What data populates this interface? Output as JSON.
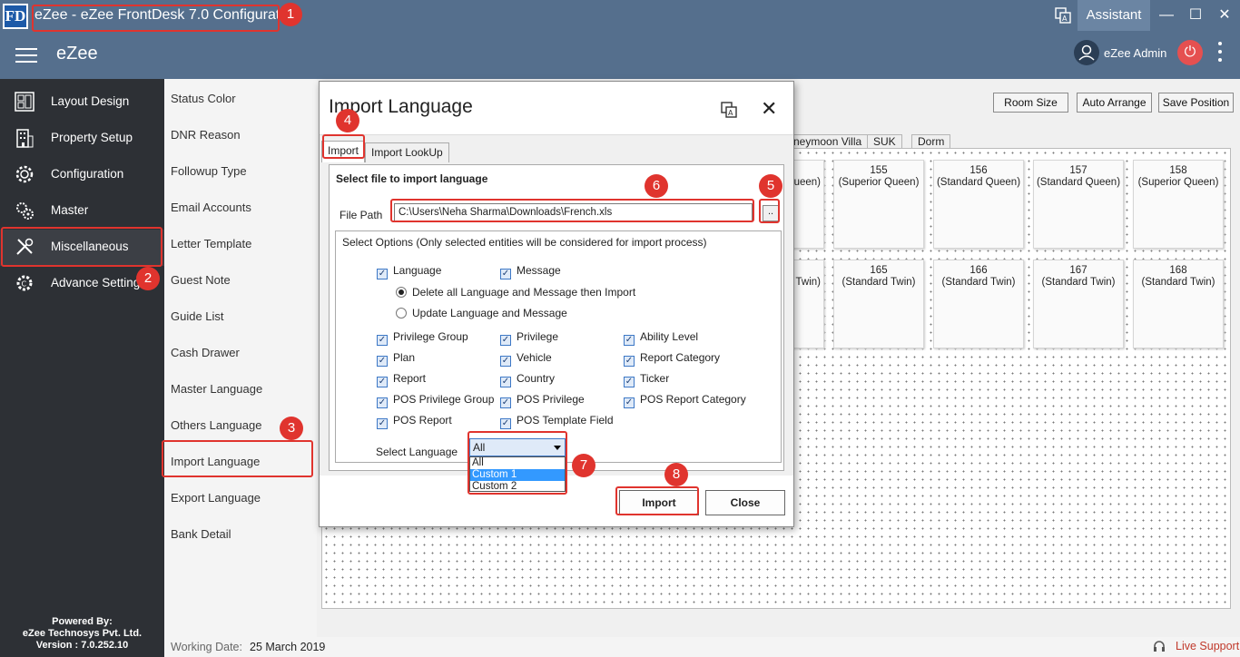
{
  "window": {
    "logo_text": "FD",
    "title": "eZee - eZee FrontDesk 7.0 Configuration",
    "assistant_label": "Assistant",
    "minimize": "—",
    "maximize": "☐",
    "close": "✕"
  },
  "header": {
    "brand": "eZee",
    "user_name": "eZee Admin",
    "power_icon": "⏻"
  },
  "sidebar": {
    "items": [
      {
        "label": "Layout Design",
        "icon": "layout-icon"
      },
      {
        "label": "Property Setup",
        "icon": "building-icon"
      },
      {
        "label": "Configuration",
        "icon": "gear-icon"
      },
      {
        "label": "Master",
        "icon": "gears-icon"
      },
      {
        "label": "Miscellaneous",
        "icon": "tools-icon"
      },
      {
        "label": "Advance Setting",
        "icon": "advance-gear-icon"
      }
    ],
    "footer": {
      "powered_by": "Powered By:",
      "company": "eZee Technosys Pvt. Ltd.",
      "version": "Version : 7.0.252.10"
    }
  },
  "submenu": {
    "items": [
      "Status Color",
      "DNR Reason",
      "Followup Type",
      "Email Accounts",
      "Letter Template",
      "Guest Note",
      "Guide List",
      "Cash Drawer",
      "Master Language",
      "Others Language",
      "Import Language",
      "Export Language",
      "Bank Detail"
    ]
  },
  "main": {
    "buttons": {
      "room_size": "Room Size",
      "auto_arrange": "Auto Arrange",
      "save_position": "Save Position"
    },
    "room_tabs": [
      "neymoon Villa",
      "SUK",
      "Dorm"
    ],
    "rooms_row1": [
      {
        "partial": "ueen)"
      },
      {
        "number": "155",
        "type": "(Superior Queen)"
      },
      {
        "number": "156",
        "type": "(Standard Queen)"
      },
      {
        "number": "157",
        "type": "(Standard Queen)"
      },
      {
        "number": "158",
        "type": "(Superior Queen)"
      }
    ],
    "rooms_row2": [
      {
        "partial": "Twin)"
      },
      {
        "number": "165",
        "type": "(Standard Twin)"
      },
      {
        "number": "166",
        "type": "(Standard Twin)"
      },
      {
        "number": "167",
        "type": "(Standard Twin)"
      },
      {
        "number": "168",
        "type": "(Standard Twin)"
      }
    ]
  },
  "statusbar": {
    "working_date_label": "Working Date:",
    "working_date_value": "25 March 2019",
    "live_support": "Live Support"
  },
  "dialog": {
    "title": "Import Language",
    "close": "✕",
    "tabs": [
      "Import",
      "Import LookUp"
    ],
    "section_title": "Select file to import language",
    "file_path_label": "File Path",
    "file_path_value": "C:\\Users\\Neha Sharma\\Downloads\\French.xls",
    "browse_label": "..",
    "options_title": "Select Options (Only selected entities will be considered for import process)",
    "check_language": "Language",
    "check_message": "Message",
    "radio_delete": "Delete all Language and Message then Import",
    "radio_update": "Update Language and Message",
    "entities": [
      [
        "Privilege Group",
        "Privilege",
        "Ability Level"
      ],
      [
        "Plan",
        "Vehicle",
        "Report Category"
      ],
      [
        "Report",
        "Country",
        "Ticker"
      ],
      [
        "POS Privilege Group",
        "POS Privilege",
        "POS Report Category"
      ],
      [
        "POS Report",
        "POS Template Field"
      ]
    ],
    "select_language_label": "Select Language",
    "select_language_value": "All",
    "dropdown_options": [
      "All",
      "Custom 1",
      "Custom 2"
    ],
    "import_button": "Import",
    "close_button": "Close",
    "check_mark": "✓"
  },
  "annotations": [
    "1",
    "2",
    "3",
    "4",
    "5",
    "6",
    "7",
    "8"
  ],
  "colors": {
    "titlebar": "#556f8d",
    "sidebar": "#2d3035",
    "annotation": "#e0342e",
    "dropdown_highlight": "#3399ff"
  }
}
